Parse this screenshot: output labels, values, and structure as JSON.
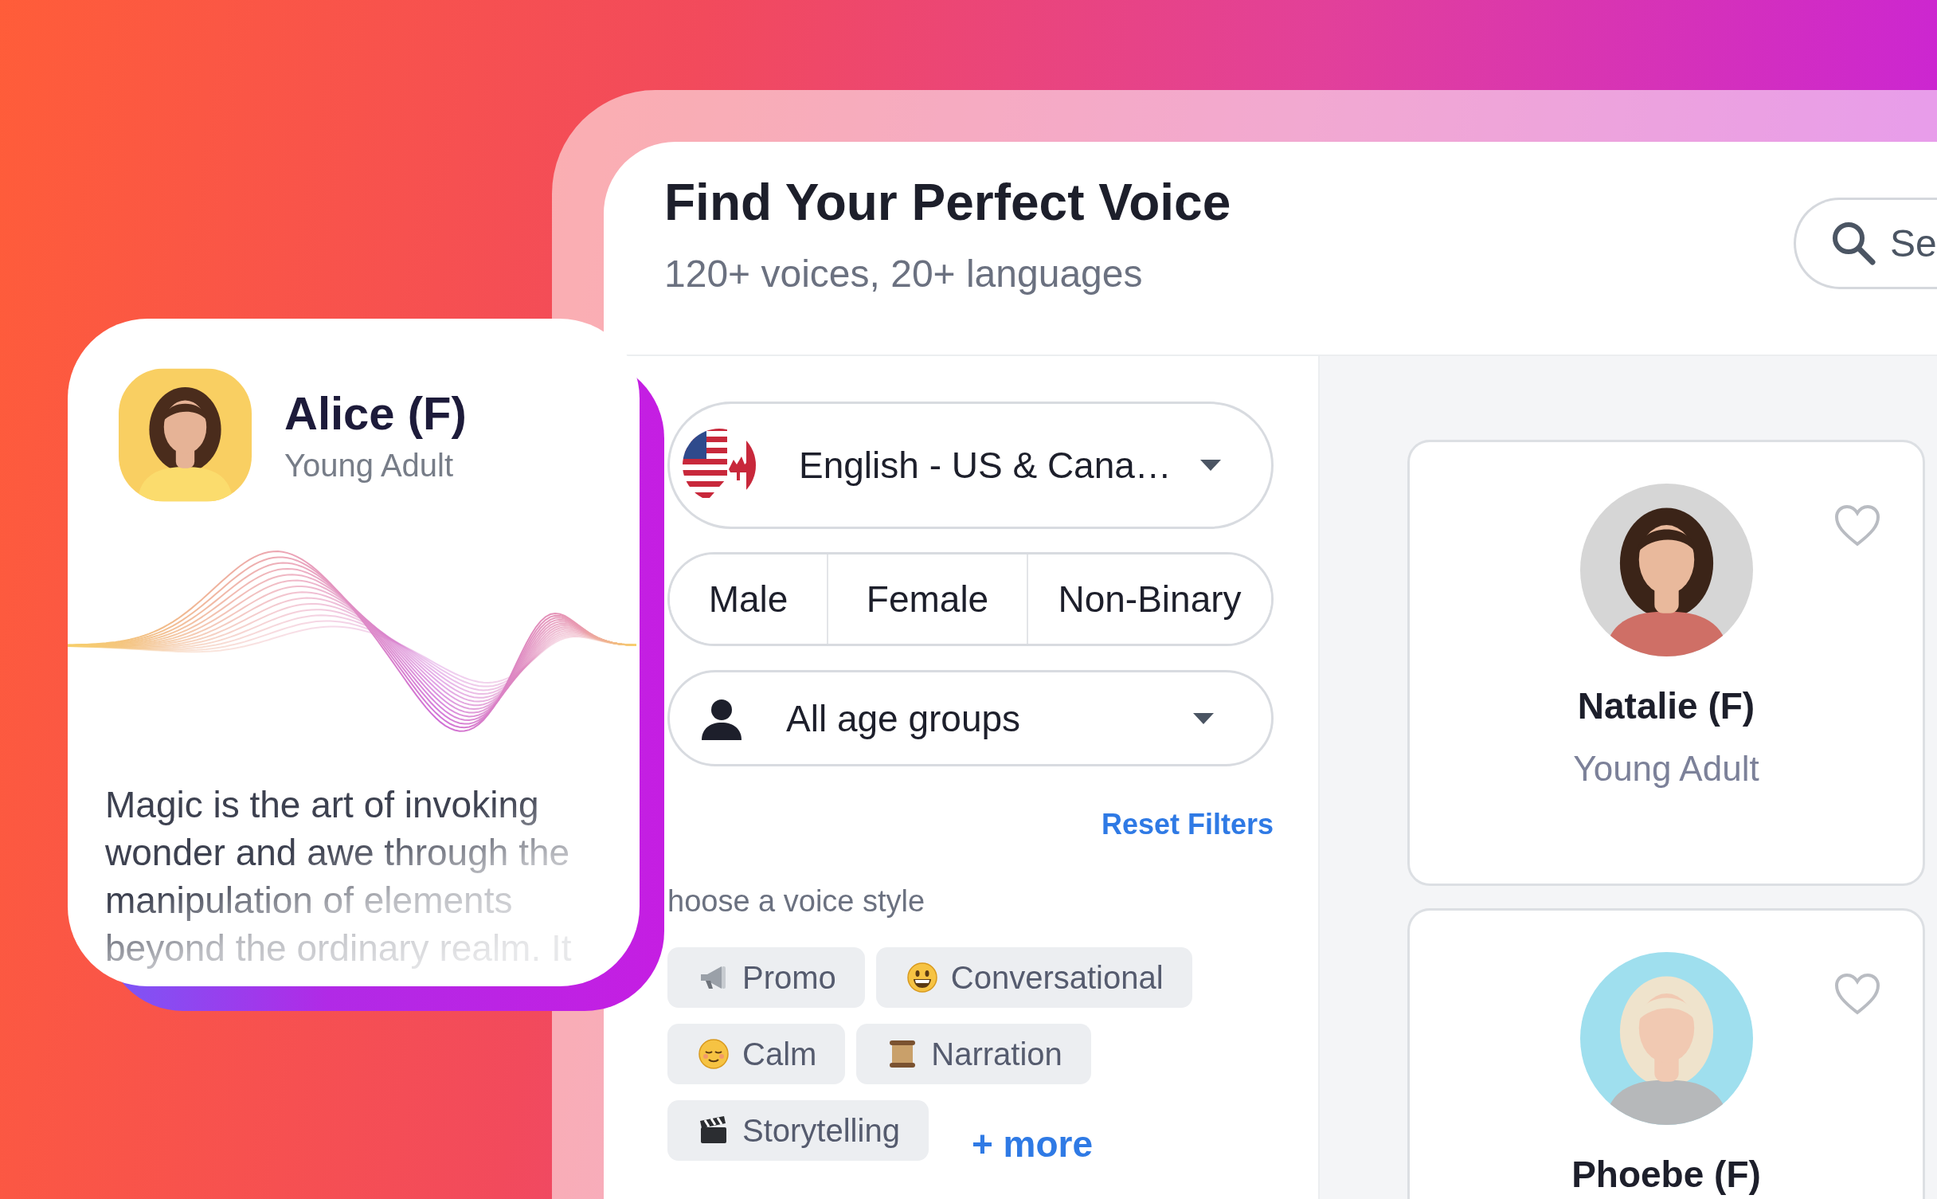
{
  "header": {
    "title": "Find Your Perfect Voice",
    "subtitle": "120+ voices, 20+ languages",
    "search": {
      "placeholder": "Se"
    }
  },
  "filters": {
    "language": {
      "value": "English - US & Cana…"
    },
    "genders": [
      {
        "label": "Male",
        "selected": false
      },
      {
        "label": "Female",
        "selected": false
      },
      {
        "label": "Non-Binary",
        "selected": false
      }
    ],
    "age": {
      "value": "All age groups"
    },
    "reset": "Reset Filters",
    "style_prompt": "hoose a voice style",
    "styles": [
      {
        "label": "Promo",
        "kind": "megaphone"
      },
      {
        "label": "Conversational",
        "kind": "grin"
      },
      {
        "label": "Calm",
        "kind": "relieved"
      },
      {
        "label": "Narration",
        "kind": "scroll"
      },
      {
        "label": "Storytelling",
        "kind": "clapper"
      }
    ],
    "more": "+ more"
  },
  "voices": [
    {
      "name": "Natalie (F)",
      "age": "Young Adult",
      "favorite": false
    },
    {
      "name": "Phoebe (F)",
      "favorite": false
    }
  ],
  "preview": {
    "name": "Alice (F)",
    "age": "Young Adult",
    "text": "Magic is the art of invoking wonder and awe through the manipulation of elements beyond the ordinary realm. It"
  }
}
